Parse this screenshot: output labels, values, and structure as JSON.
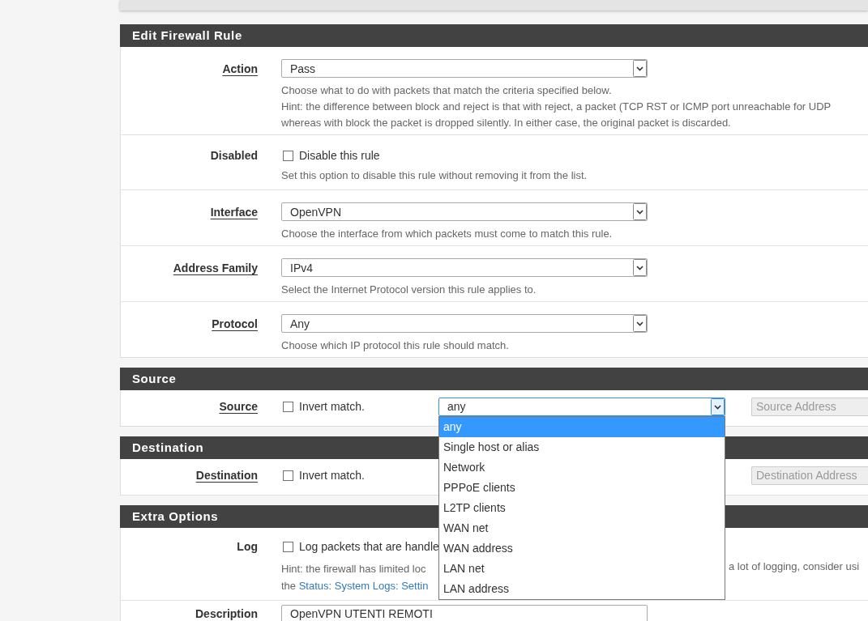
{
  "sections": [
    {
      "title": "Edit Firewall Rule",
      "rows": [
        {
          "kind": "select",
          "label": "Action",
          "underlined": true,
          "value": "Pass",
          "help": [
            "Choose what to do with packets that match the criteria specified below.",
            "Hint: the difference between block and reject is that with reject, a packet (TCP RST or ICMP port unreachable for UDP",
            "whereas with block the packet is dropped silently. In either case, the original packet is discarded."
          ]
        },
        {
          "kind": "checkbox",
          "label": "Disabled",
          "underlined": false,
          "checked": false,
          "checkbox_label": "Disable this rule",
          "help": [
            "Set this option to disable this rule without removing it from the list."
          ]
        },
        {
          "kind": "select",
          "label": "Interface",
          "underlined": true,
          "value": "OpenVPN",
          "help": [
            "Choose the interface from which packets must come to match this rule."
          ]
        },
        {
          "kind": "select",
          "label": "Address Family",
          "underlined": true,
          "value": "IPv4",
          "help": [
            "Select the Internet Protocol version this rule applies to."
          ]
        },
        {
          "kind": "select",
          "label": "Protocol",
          "underlined": true,
          "value": "Any",
          "help": [
            "Choose which IP protocol this rule should match."
          ]
        }
      ]
    },
    {
      "title": "Source",
      "rows": [
        {
          "kind": "address",
          "label": "Source",
          "underlined": true,
          "checked": false,
          "checkbox_label": "Invert match.",
          "select": {
            "value": "any",
            "focused": true,
            "options": [
              {
                "label": "any",
                "selected": true
              },
              {
                "label": "Single host or alias",
                "selected": false
              },
              {
                "label": "Network",
                "selected": false
              },
              {
                "label": "PPPoE clients",
                "selected": false
              },
              {
                "label": "L2TP clients",
                "selected": false
              },
              {
                "label": "WAN net",
                "selected": false
              },
              {
                "label": "WAN address",
                "selected": false
              },
              {
                "label": "LAN net",
                "selected": false
              },
              {
                "label": "LAN address",
                "selected": false
              }
            ]
          },
          "address_placeholder": "Source Address"
        }
      ]
    },
    {
      "title": "Destination",
      "rows": [
        {
          "kind": "address",
          "label": "Destination",
          "underlined": true,
          "checked": false,
          "checkbox_label": "Invert match.",
          "address_placeholder": "Destination Address"
        }
      ]
    },
    {
      "title": "Extra Options",
      "rows": [
        {
          "kind": "log",
          "label": "Log",
          "underlined": false,
          "checked": false,
          "checkbox_label": "Log packets that are handle",
          "hint_left": "Hint: the firewall has limited loc",
          "hint_right": "a lot of logging, consider usi",
          "hint_line2": "the",
          "hint_link": "Status: System Logs: Settin"
        },
        {
          "kind": "text",
          "label": "Description",
          "underlined": false,
          "value": "OpenVPN UTENTI REMOTI"
        }
      ]
    }
  ]
}
